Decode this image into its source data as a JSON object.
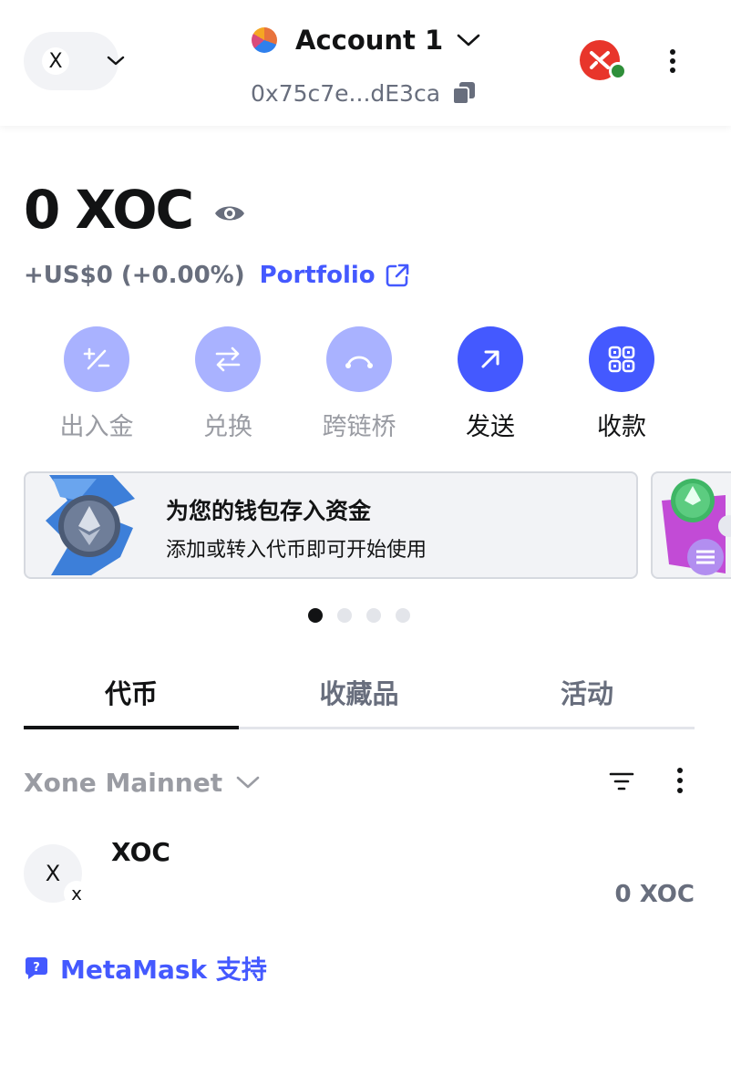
{
  "header": {
    "network_avatar_letter": "X",
    "account_name": "Account 1",
    "address": "0x75c7e...dE3ca"
  },
  "balance": {
    "amount": "0 XOC",
    "fiat_change": "+US$0 (+0.00%)",
    "portfolio_label": "Portfolio"
  },
  "actions": [
    {
      "label": "出入金",
      "icon": "plus-minus-icon"
    },
    {
      "label": "兑换",
      "icon": "swap-arrows-icon"
    },
    {
      "label": "跨链桥",
      "icon": "bridge-icon"
    },
    {
      "label": "发送",
      "icon": "arrow-up-right-icon"
    },
    {
      "label": "收款",
      "icon": "qr-code-icon"
    }
  ],
  "banner": {
    "title": "为您的钱包存入资金",
    "subtitle": "添加或转入代币即可开始使用"
  },
  "carousel": {
    "total": 4,
    "active_index": 0
  },
  "tabs": [
    {
      "label": "代币",
      "active": true
    },
    {
      "label": "收藏品",
      "active": false
    },
    {
      "label": "活动",
      "active": false
    }
  ],
  "token_list": {
    "network_filter": "Xone Mainnet",
    "tokens": [
      {
        "avatar_letter": "X",
        "badge_letter": "x",
        "name": "XOC",
        "balance": "0 XOC"
      }
    ]
  },
  "support": {
    "label": "MetaMask 支持"
  },
  "colors": {
    "accent": "#4459ff",
    "accent_light": "#a9b2ff",
    "muted_text": "#686e7d",
    "status_connected": "#2f8f3a"
  }
}
